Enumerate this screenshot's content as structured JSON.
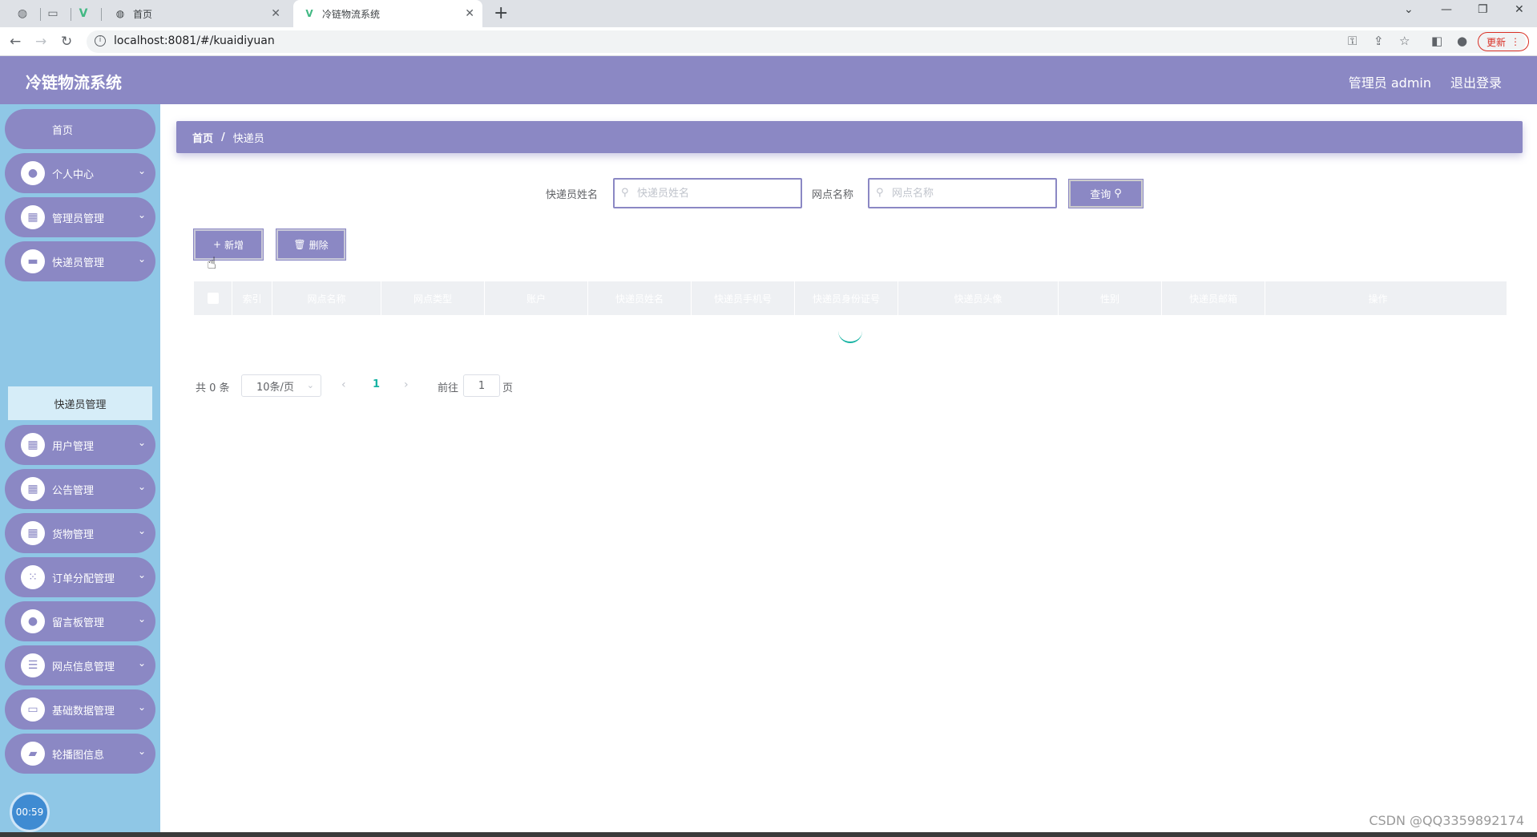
{
  "browser": {
    "tabs": [
      {
        "title": "首页",
        "active": false
      },
      {
        "title": "冷链物流系统",
        "active": true
      }
    ],
    "url": "localhost:8081/#/kuaidiyuan",
    "update_label": "更新"
  },
  "header": {
    "app_title": "冷链物流系统",
    "user_label": "管理员 admin",
    "logout_label": "退出登录"
  },
  "sidebar": {
    "items": [
      {
        "label": "首页",
        "icon": "home"
      },
      {
        "label": "个人中心",
        "icon": "user-icon"
      },
      {
        "label": "管理员管理",
        "icon": "grid-icon"
      },
      {
        "label": "快递员管理",
        "icon": "courier-icon",
        "expanded": true
      },
      {
        "label": "用户管理",
        "icon": "grid-icon"
      },
      {
        "label": "公告管理",
        "icon": "grid-icon"
      },
      {
        "label": "货物管理",
        "icon": "grid-icon"
      },
      {
        "label": "订单分配管理",
        "icon": "apps-icon"
      },
      {
        "label": "留言板管理",
        "icon": "user-icon"
      },
      {
        "label": "网点信息管理",
        "icon": "sliders-icon"
      },
      {
        "label": "基础数据管理",
        "icon": "monitor-icon"
      },
      {
        "label": "轮播图信息",
        "icon": "briefcase-icon"
      }
    ],
    "submenu": {
      "label": "快递员管理"
    },
    "timer": "00:59"
  },
  "breadcrumb": {
    "home": "首页",
    "current": "快递员"
  },
  "search": {
    "name_label": "快递员姓名",
    "name_placeholder": "快递员姓名",
    "name_value": "",
    "site_label": "网点名称",
    "site_placeholder": "网点名称",
    "site_value": "",
    "query_label": "查询"
  },
  "actions": {
    "add_label": "新增",
    "delete_label": "删除"
  },
  "table": {
    "columns": [
      "索引",
      "网点名称",
      "网点类型",
      "账户",
      "快递员姓名",
      "快递员手机号",
      "快递员身份证号",
      "快递员头像",
      "性别",
      "快递员邮箱",
      "操作"
    ],
    "rows": []
  },
  "pagination": {
    "total_label": "共 0 条",
    "page_size": "10条/页",
    "current_page": "1",
    "goto_prefix": "前往",
    "goto_value": "1",
    "goto_suffix": "页"
  },
  "watermark": "CSDN @QQ3359892174",
  "colors": {
    "primary": "#8b88c4",
    "sidebar": "#8fc7e6",
    "accent": "#17b3a3"
  }
}
